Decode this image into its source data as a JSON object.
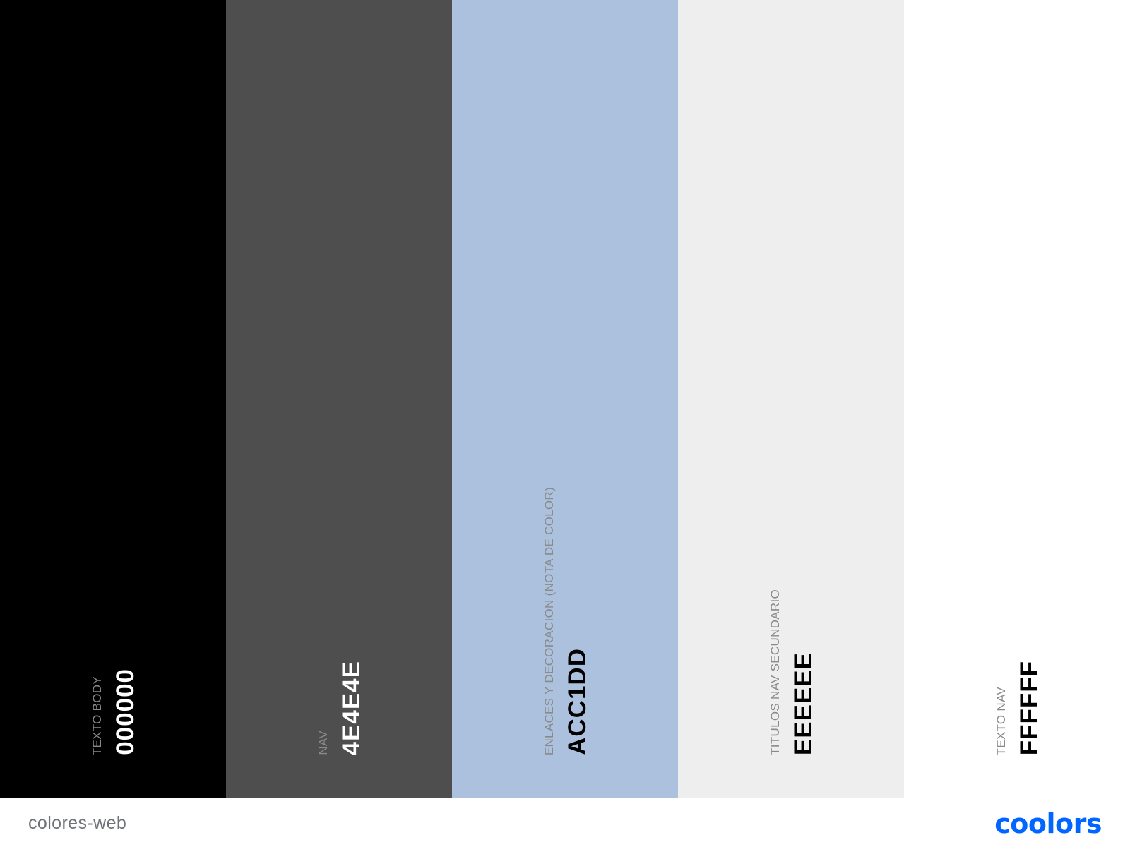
{
  "palette": {
    "swatches": [
      {
        "label": "TEXTO BODY",
        "hex": "000000",
        "color": "#000000",
        "text_color": "#ffffff"
      },
      {
        "label": "NAV",
        "hex": "4E4E4E",
        "color": "#4E4E4E",
        "text_color": "#ffffff"
      },
      {
        "label": "ENLACES Y DECORACION (NOTA DE COLOR)",
        "hex": "ACC1DD",
        "color": "#ACC1DD",
        "text_color": "#000000"
      },
      {
        "label": "TITULOS NAV SECUNDARIO",
        "hex": "EEEEEE",
        "color": "#EEEEEE",
        "text_color": "#000000"
      },
      {
        "label": "TEXTO NAV",
        "hex": "FFFFFF",
        "color": "#FFFFFF",
        "text_color": "#000000"
      }
    ]
  },
  "footer": {
    "palette_name": "colores-web",
    "logo": "coolors",
    "logo_color": "#0066FF"
  }
}
